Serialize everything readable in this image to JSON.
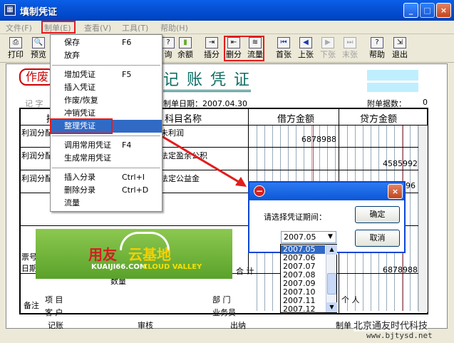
{
  "window": {
    "title": "填制凭证",
    "min": "_",
    "max": "□",
    "close": "×"
  },
  "menubar": [
    "文件(F)",
    "制单(E)",
    "查看(V)",
    "工具(T)",
    "帮助(H)"
  ],
  "toolbar": [
    {
      "label": "打印",
      "icon": "printer-icon",
      "glyph": "⎙"
    },
    {
      "label": "预览",
      "icon": "preview-icon",
      "glyph": "🔍"
    },
    {
      "label": "询",
      "icon": "query-icon",
      "glyph": "?"
    },
    {
      "label": "余额",
      "icon": "balance-chart-icon",
      "glyph": "▮"
    },
    {
      "label": "插分",
      "icon": "insert-entry-icon",
      "glyph": "⇥"
    },
    {
      "label": "删分",
      "icon": "delete-entry-icon",
      "glyph": "⇤"
    },
    {
      "label": "流量",
      "icon": "cashflow-icon",
      "glyph": "≋"
    },
    {
      "label": "首张",
      "icon": "first-record-icon",
      "glyph": "⏮"
    },
    {
      "label": "上张",
      "icon": "prev-record-icon",
      "glyph": "◀"
    },
    {
      "label": "下张",
      "icon": "next-record-icon",
      "glyph": "▶"
    },
    {
      "label": "末张",
      "icon": "last-record-icon",
      "glyph": "⏭"
    },
    {
      "label": "帮助",
      "icon": "help-icon",
      "glyph": "?"
    },
    {
      "label": "退出",
      "icon": "exit-icon",
      "glyph": "⇲"
    }
  ],
  "menu": {
    "items": [
      {
        "label": "保存",
        "shortcut": "F6"
      },
      {
        "label": "放弃",
        "shortcut": ""
      },
      {
        "label": "增加凭证",
        "shortcut": "F5"
      },
      {
        "label": "插入凭证",
        "shortcut": ""
      },
      {
        "label": "作废/恢复",
        "shortcut": ""
      },
      {
        "label": "冲销凭证",
        "shortcut": ""
      },
      {
        "label": "整理凭证",
        "shortcut": ""
      },
      {
        "label": "调用常用凭证",
        "shortcut": "F4"
      },
      {
        "label": "生成常用凭证",
        "shortcut": ""
      },
      {
        "label": "插入分录",
        "shortcut": "Ctrl+I"
      },
      {
        "label": "删除分录",
        "shortcut": "Ctrl+D"
      },
      {
        "label": "流量",
        "shortcut": ""
      }
    ]
  },
  "voucher": {
    "void_stamp": "作废",
    "title": "记 账 凭 证",
    "type_label": "记 字",
    "date_label": "制单日期：2007.04.30",
    "attach_label": "附单据数：",
    "attach_value": "0",
    "col_summary": "摘",
    "col_subject": "科目名称",
    "col_debit": "借方金额",
    "col_credit": "贷方金额",
    "rows": [
      {
        "summary": "利润分配",
        "subject": "未利润",
        "debit": "6878988",
        "credit": ""
      },
      {
        "summary": "利润分配",
        "subject": "法定盈余公积",
        "debit": "",
        "credit": "4585992"
      },
      {
        "summary": "利润分配",
        "subject": "法定公益金",
        "debit": "",
        "credit": "96"
      }
    ],
    "ticket_label": "票号",
    "date_row_label": "日期",
    "qty_label": "数量",
    "total_label": "合 计",
    "total_debit": "6878988",
    "remarks_label": "备注",
    "project_label": "项 目",
    "dept_label": "部 门",
    "person_label": "个 人",
    "customer_label": "客 户",
    "salesman_label": "业务员",
    "footer": [
      "记账",
      "审核",
      "出纳",
      "制单"
    ]
  },
  "banner": {
    "brand": "用友",
    "brand2": "云基地",
    "site": "KUAIJI66.COM",
    "tagline": "CLOUD VALLEY"
  },
  "dialog": {
    "prompt": "请选择凭证期间：",
    "ok": "确定",
    "cancel": "取消",
    "selected": "2007.05",
    "options": [
      "2007.05",
      "2007.06",
      "2007.07",
      "2007.08",
      "2007.09",
      "2007.10",
      "2007.11",
      "2007.12"
    ]
  },
  "watermark": {
    "name": "北京通友时代科技",
    "url": "www.bjtysd.net"
  },
  "colors": {
    "titlebar": "#0a5fe8",
    "highlight": "#316ac5",
    "annotation": "#e21d1d"
  }
}
